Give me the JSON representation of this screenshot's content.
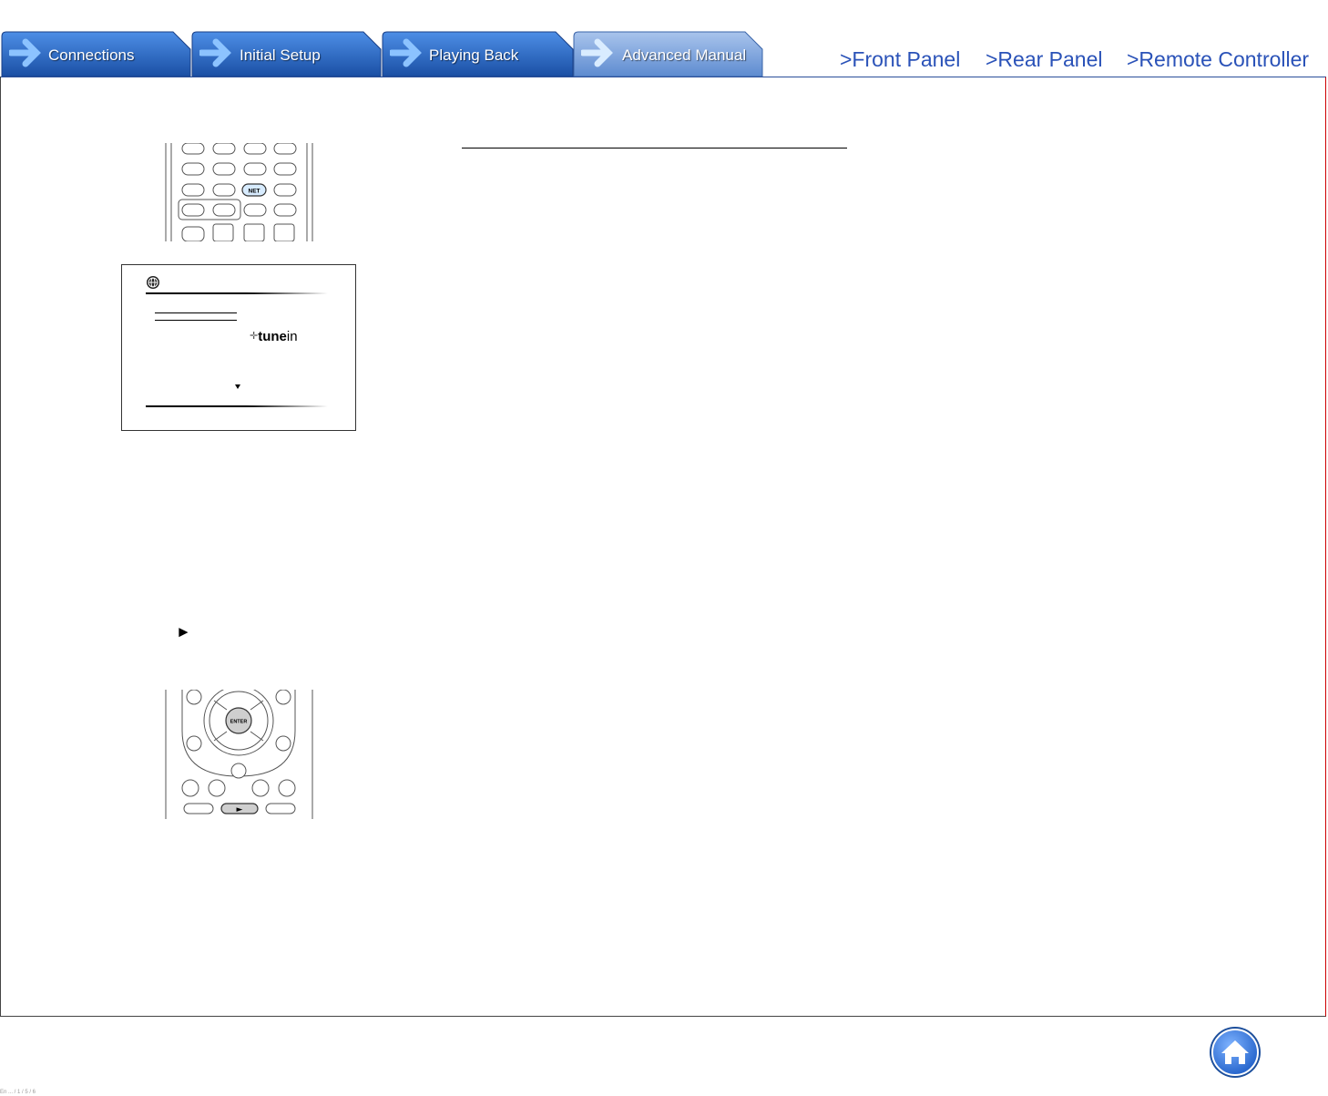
{
  "tabs": [
    {
      "label": "Connections",
      "active": false
    },
    {
      "label": "Initial Setup",
      "active": false
    },
    {
      "label": "Playing Back",
      "active": false
    },
    {
      "label": "Advanced Manual",
      "active": true
    }
  ],
  "top_links": [
    {
      "label": ">Front Panel"
    },
    {
      "label": ">Rear Panel"
    },
    {
      "label": ">Remote Controller"
    }
  ],
  "remote_top": {
    "net_button_label": "NET"
  },
  "screen": {
    "service_logo_text": "tune",
    "service_logo_text_2": "in"
  },
  "play_symbol": "►",
  "remote_bottom": {
    "enter_button_label": "ENTER",
    "play_button_label": "►"
  },
  "footer_text": "En ... / 1 / 5 / 6",
  "colors": {
    "tab_blue": "#1f5db4",
    "tab_active": "#7fa6da",
    "link_blue": "#2a52b8",
    "home_blue": "#2e6fd4"
  }
}
